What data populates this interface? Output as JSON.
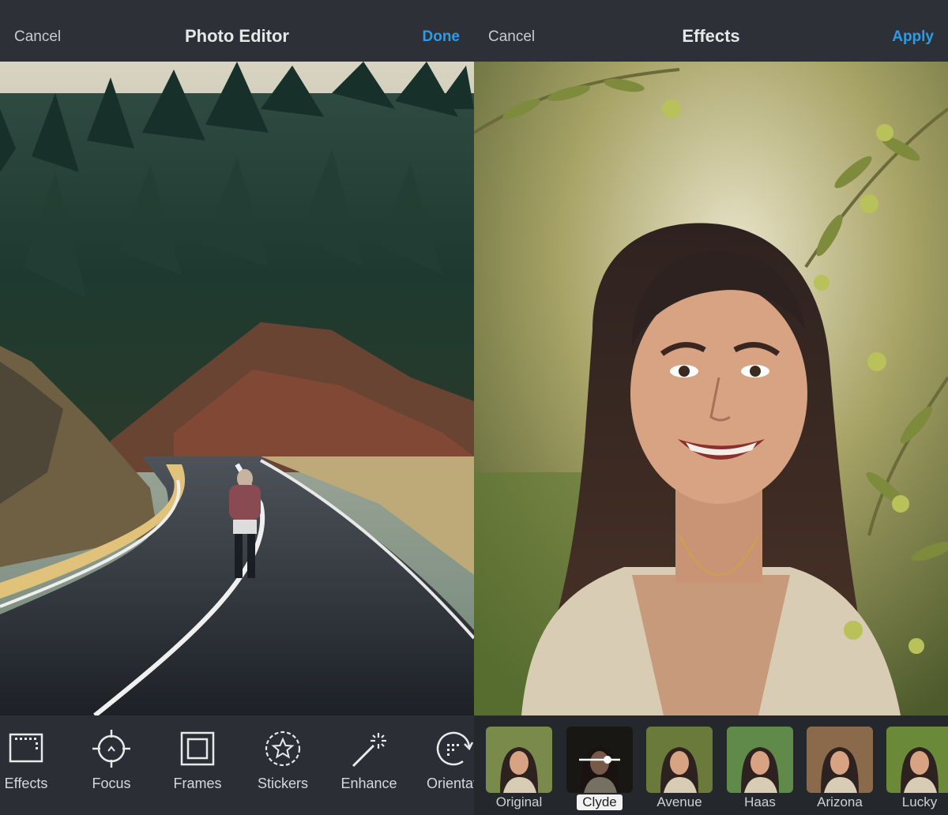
{
  "left_screen": {
    "nav": {
      "cancel": "Cancel",
      "title": "Photo Editor",
      "done": "Done"
    },
    "tools": [
      {
        "label": "Effects",
        "icon": "film-frame-icon"
      },
      {
        "label": "Focus",
        "icon": "crosshair-icon"
      },
      {
        "label": "Frames",
        "icon": "square-frame-icon"
      },
      {
        "label": "Stickers",
        "icon": "star-badge-icon"
      },
      {
        "label": "Enhance",
        "icon": "magic-wand-icon"
      },
      {
        "label": "Orientati",
        "icon": "rotate-icon"
      }
    ]
  },
  "right_screen": {
    "nav": {
      "cancel": "Cancel",
      "title": "Effects",
      "apply": "Apply"
    },
    "filters": [
      {
        "label": "Original"
      },
      {
        "label": "Clyde",
        "selected": true
      },
      {
        "label": "Avenue"
      },
      {
        "label": "Haas"
      },
      {
        "label": "Arizona"
      },
      {
        "label": "Lucky"
      }
    ]
  },
  "colors": {
    "accent": "#2d9be6",
    "bar": "#2d3036"
  }
}
